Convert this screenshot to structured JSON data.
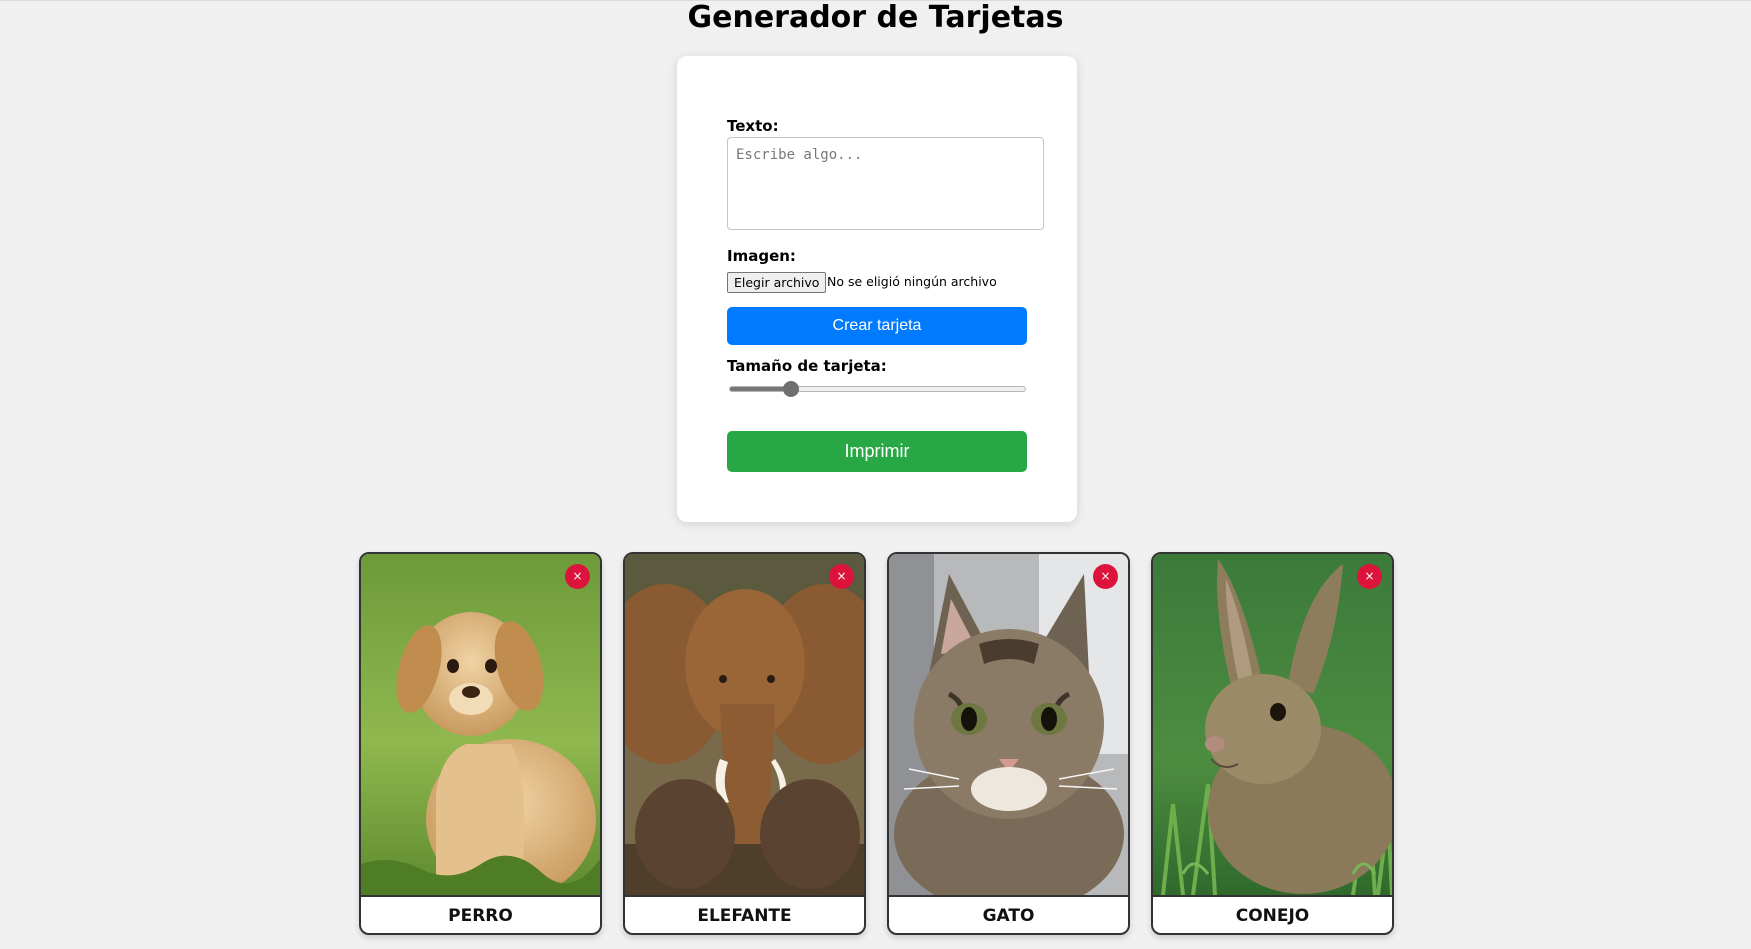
{
  "page": {
    "title": "Generador de Tarjetas"
  },
  "form": {
    "text_label": "Texto:",
    "text_placeholder": "Escribe algo...",
    "text_value": "",
    "image_label": "Imagen:",
    "file_button_label": "Elegir archivo",
    "file_status": "No se eligió ningún archivo",
    "create_button_label": "Crear tarjeta",
    "size_label": "Tamaño de tarjeta:",
    "size_slider_value": 0.21,
    "print_button_label": "Imprimir"
  },
  "cards": [
    {
      "caption": "PERRO",
      "close_label": "×",
      "image_icon": "puppy-photo"
    },
    {
      "caption": "ELEFANTE",
      "close_label": "×",
      "image_icon": "elephant-photo"
    },
    {
      "caption": "GATO",
      "close_label": "×",
      "image_icon": "kitten-photo"
    },
    {
      "caption": "CONEJO",
      "close_label": "×",
      "image_icon": "rabbit-photo"
    }
  ],
  "colors": {
    "background": "#f0f0f0",
    "create_button": "#007bff",
    "print_button": "#28a745",
    "close_button": "#dc143c"
  }
}
